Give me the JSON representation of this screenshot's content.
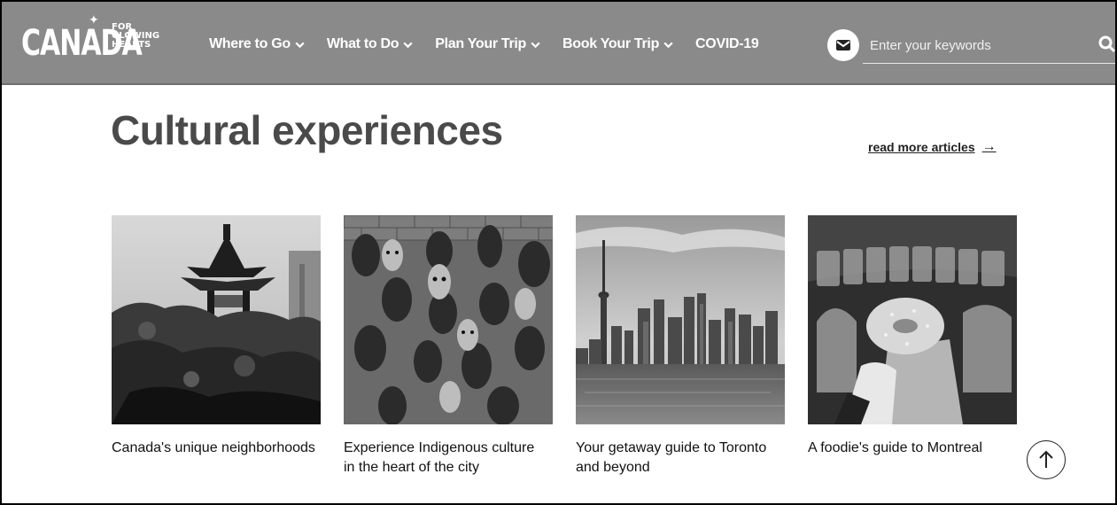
{
  "header": {
    "logo_text": "CANADA",
    "tagline": [
      "FOR",
      "GLOWING",
      "HEARTS"
    ],
    "nav": [
      {
        "label": "Where to Go",
        "has_dropdown": true
      },
      {
        "label": "What to Do",
        "has_dropdown": true
      },
      {
        "label": "Plan Your Trip",
        "has_dropdown": true
      },
      {
        "label": "Book Your Trip",
        "has_dropdown": true
      },
      {
        "label": "COVID-19",
        "has_dropdown": false
      }
    ],
    "search": {
      "placeholder": "Enter your keywords",
      "value": ""
    },
    "icons": {
      "mail": "envelope-icon",
      "search": "search-icon",
      "dropdown": "chevron-down-icon"
    }
  },
  "main": {
    "title": "Cultural experiences",
    "read_more": "read more articles",
    "read_more_arrow": "→",
    "cards": [
      {
        "title": "Canada's unique neighborhoods",
        "image": "chinese-pagoda-garden"
      },
      {
        "title": "Experience Indigenous culture in the heart of the city",
        "image": "carved-masks-brick-wall"
      },
      {
        "title": "Your getaway guide to Toronto and beyond",
        "image": "toronto-skyline-cn-tower"
      },
      {
        "title": "A foodie's guide to Montreal",
        "image": "montreal-bagel-shop"
      }
    ]
  },
  "back_to_top": {
    "icon": "arrow-up-icon"
  },
  "colors": {
    "header_bg": "#8a8a8a",
    "title": "#4a4a4a",
    "text": "#111111"
  }
}
